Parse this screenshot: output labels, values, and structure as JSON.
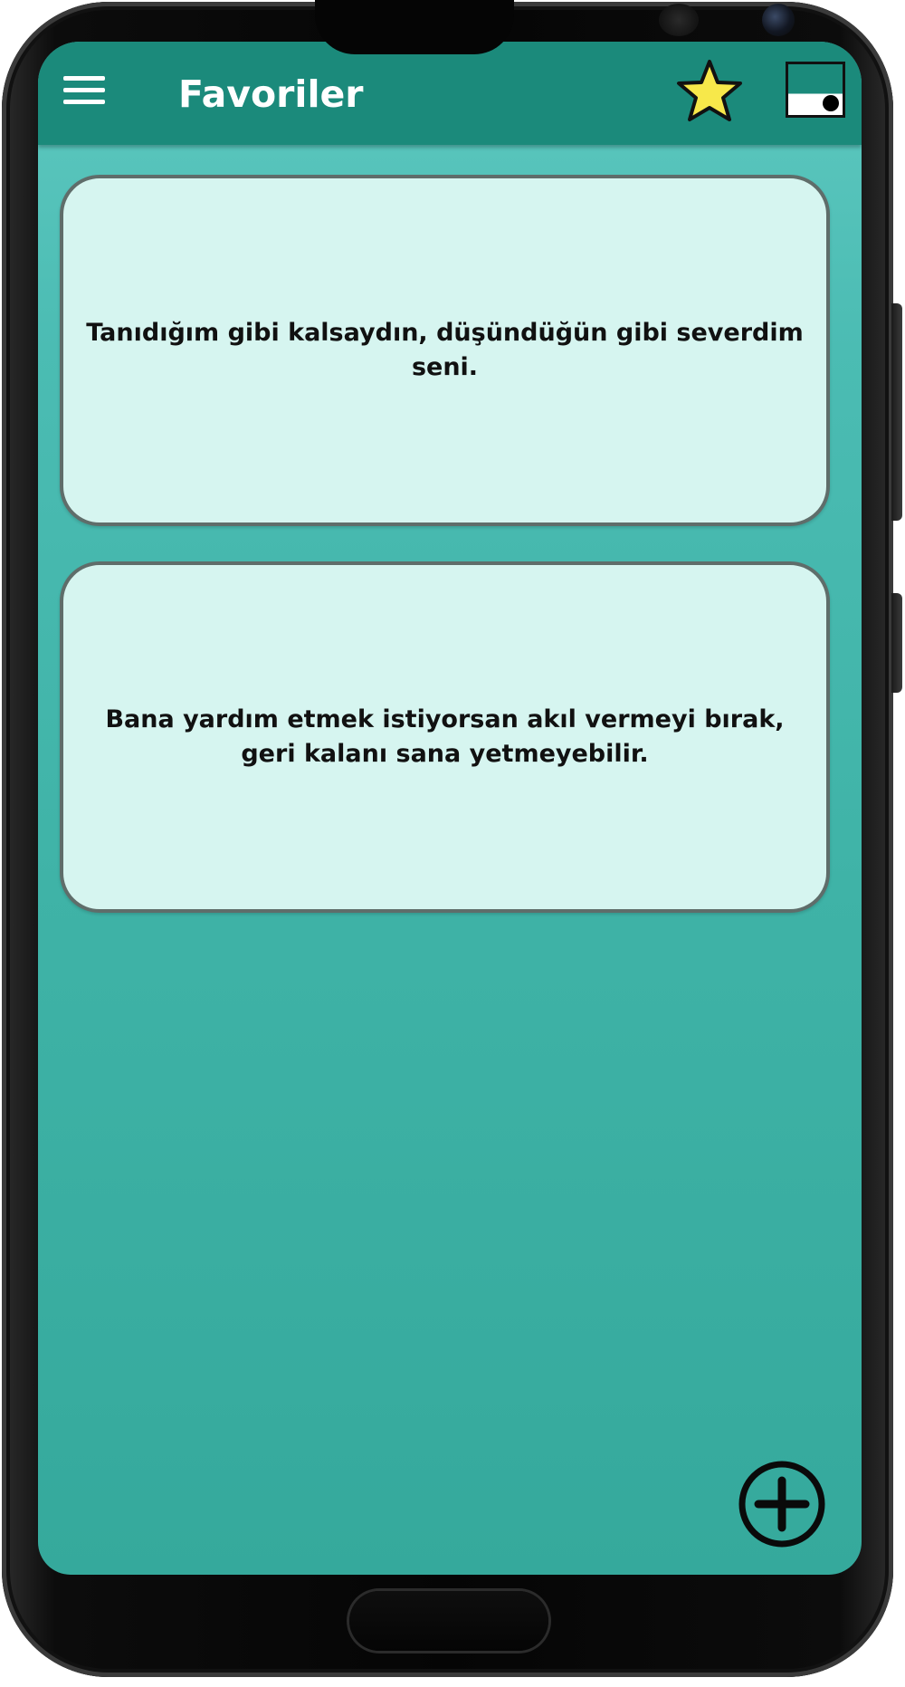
{
  "app_bar": {
    "title": "Favoriler",
    "menu_icon": "hamburger-menu-icon",
    "favorites_icon": "star-icon",
    "theme_icon": "theme-toggle-icon",
    "colors": {
      "bar": "#1b8a7b",
      "star_fill": "#f7e84a"
    }
  },
  "favorites": [
    {
      "text": "Tanıdığım gibi kalsaydın, düşündüğün gibi severdim seni."
    },
    {
      "text": "Bana yardım etmek istiyorsan akıl vermeyi bırak, geri kalanı sana yetmeyebilir."
    }
  ],
  "fab": {
    "icon": "plus-circle-icon"
  },
  "colors": {
    "card_background": "#d6f5f0",
    "screen_background": "#44b8ad"
  }
}
